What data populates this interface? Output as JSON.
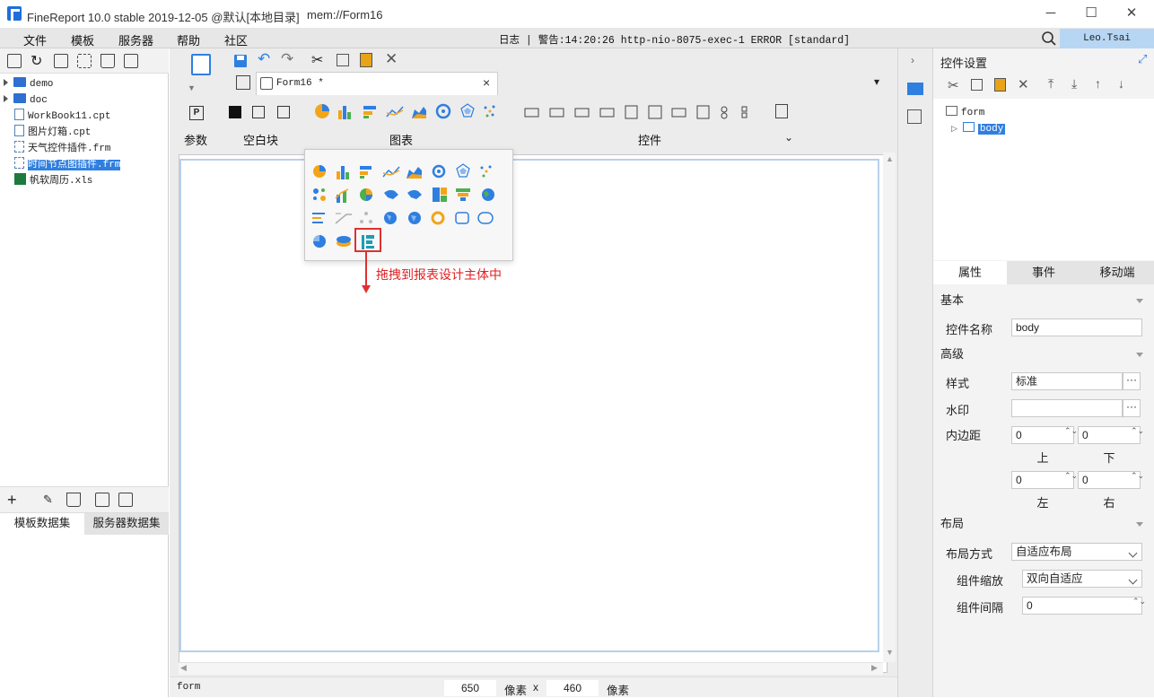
{
  "window": {
    "title": "FineReport 10.0 stable 2019-12-05 @默认[本地目录]",
    "file_path": "mem://Form16",
    "minimize": "─",
    "maximize": "☐",
    "close": "✕"
  },
  "menu": [
    "文件",
    "模板",
    "服务器",
    "帮助",
    "社区"
  ],
  "log": {
    "label": "日志",
    "warning": "警告:14:20:26 http-nio-8075-exec-1 ERROR [standard]"
  },
  "user": {
    "name": "Leo.Tsai"
  },
  "file_tree": [
    {
      "type": "folder",
      "name": "demo"
    },
    {
      "type": "folder",
      "name": "doc"
    },
    {
      "type": "cpt",
      "name": "WorkBook11.cpt"
    },
    {
      "type": "cpt",
      "name": "图片灯箱.cpt"
    },
    {
      "type": "frm",
      "name": "天气控件插件.frm"
    },
    {
      "type": "frm",
      "name": "时间节点图插件.frm",
      "selected": true
    },
    {
      "type": "xls",
      "name": "帆软周历.xls"
    }
  ],
  "dataset_tabs": [
    "模板数据集",
    "服务器数据集"
  ],
  "doc_tab": {
    "name": "Form16 *"
  },
  "ribbon": {
    "param": "参数",
    "blank": "空白块",
    "chart": "图表",
    "widget": "控件"
  },
  "drag_note": "拖拽到报表设计主体中",
  "status": {
    "form": "form",
    "width": "650",
    "unit": "像素",
    "x": "x",
    "height": "460",
    "unit2": "像素"
  },
  "props": {
    "title": "控件设置",
    "tree": {
      "root": "form",
      "child": "body"
    },
    "tabs": [
      "属性",
      "事件",
      "移动端"
    ],
    "basic": "基本",
    "name_label": "控件名称",
    "name_value": "body",
    "advanced": "高级",
    "style_label": "样式",
    "style_value": "标准",
    "watermark_label": "水印",
    "watermark_value": "",
    "padding_label": "内边距",
    "padding": {
      "top": "0",
      "bottom": "0",
      "left": "0",
      "right": "0"
    },
    "pad_labels": {
      "top": "上",
      "bottom": "下",
      "left": "左",
      "right": "右"
    },
    "layout": "布局",
    "layout_mode_label": "布局方式",
    "layout_mode_value": "自适应布局",
    "scale_label": "组件缩放",
    "scale_value": "双向自适应",
    "gap_label": "组件间隔",
    "gap_value": "0"
  },
  "colors": {
    "accent": "#2f7fe0",
    "highlight": "#e03030",
    "user_badge": "#b7d6f3"
  }
}
